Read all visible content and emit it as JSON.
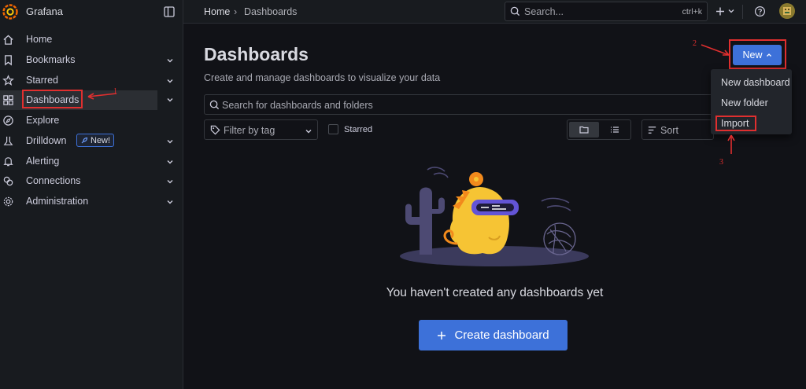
{
  "app": {
    "title": "Grafana"
  },
  "nav": {
    "items": [
      {
        "label": "Home",
        "icon": "home-icon"
      },
      {
        "label": "Bookmarks",
        "icon": "bookmark-icon"
      },
      {
        "label": "Starred",
        "icon": "star-icon"
      },
      {
        "label": "Dashboards",
        "icon": "apps-icon",
        "active": true
      },
      {
        "label": "Explore",
        "icon": "compass-icon"
      },
      {
        "label": "Drilldown",
        "icon": "drilldown-icon",
        "badge": "New!"
      },
      {
        "label": "Alerting",
        "icon": "bell-icon"
      },
      {
        "label": "Connections",
        "icon": "connections-icon"
      },
      {
        "label": "Administration",
        "icon": "cog-icon"
      }
    ]
  },
  "breadcrumb": {
    "home": "Home",
    "current": "Dashboards"
  },
  "topsearch": {
    "placeholder": "Search...",
    "shortcut": "ctrl+k"
  },
  "page": {
    "title": "Dashboards",
    "subtitle": "Create and manage dashboards to visualize your data",
    "search_placeholder": "Search for dashboards and folders",
    "filter_tag": "Filter by tag",
    "starred_label": "Starred",
    "sort_label": "Sort",
    "new_button": "New",
    "menu": [
      "New dashboard",
      "New folder",
      "Import"
    ],
    "empty_text": "You haven't created any dashboards yet",
    "create_button": "Create dashboard"
  },
  "annotations": [
    "1",
    "2",
    "3"
  ],
  "colors": {
    "accent": "#3d71d9",
    "annotation": "#e02f2f",
    "brand": "#f46800"
  }
}
